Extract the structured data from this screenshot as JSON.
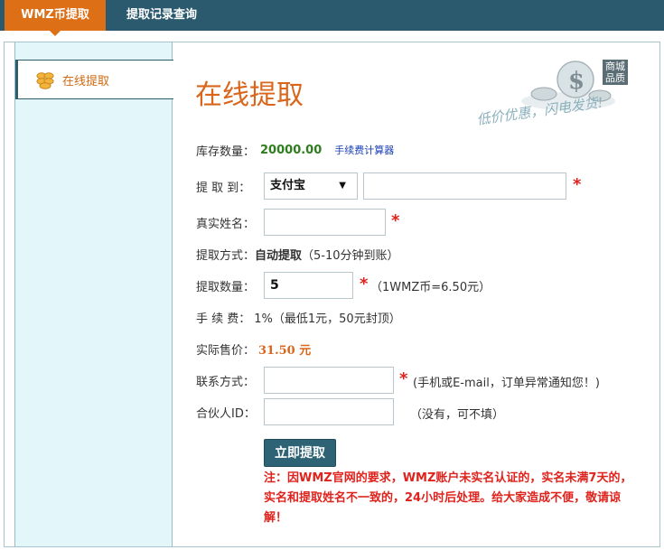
{
  "tabs": {
    "active": "WMZ币提取",
    "other": "提取记录查询"
  },
  "sidebar": {
    "item_label": "在线提取"
  },
  "page": {
    "title": "在线提取"
  },
  "banner": {
    "badge": "商城品质",
    "slogan": "低价优惠，闪电发货!"
  },
  "form": {
    "stock_label": "库存数量：",
    "stock_value": "20000.00",
    "calculator_link": "手续费计算器",
    "to_label": "提 取 到：",
    "to_select_value": "支付宝",
    "to_account_value": "",
    "name_label": "真实姓名：",
    "name_value": "",
    "method_label": "提取方式：",
    "method_value": "自动提取",
    "method_note": "（5-10分钟到账）",
    "amount_label": "提取数量：",
    "amount_value": "5",
    "amount_hint": "（1WMZ币=6.50元）",
    "fee_label": "手 续 费：",
    "fee_value": "1%（最低1元，50元封顶）",
    "price_label": "实际售价：",
    "price_value": "31.50 元",
    "contact_label": "联系方式：",
    "contact_value": "",
    "contact_hint": "(手机或E-mail，订单异常通知您！)",
    "partner_label": "合伙人ID：",
    "partner_value": "",
    "partner_hint": "（没有，可不填）",
    "required_mark": "*",
    "submit_label": "立即提取"
  },
  "notice": "注：因WMZ官网的要求，WMZ账户未实名认证的，实名未满7天的，实名和提取姓名不一致的，24小时后处理。给大家造成不便，敬请谅解！",
  "colors": {
    "header_bg": "#2b5a6e",
    "accent_orange": "#dd6f16",
    "sidebar_bg": "#e3f7fb",
    "required_red": "#e0221c",
    "stock_green": "#2e7d1e"
  }
}
